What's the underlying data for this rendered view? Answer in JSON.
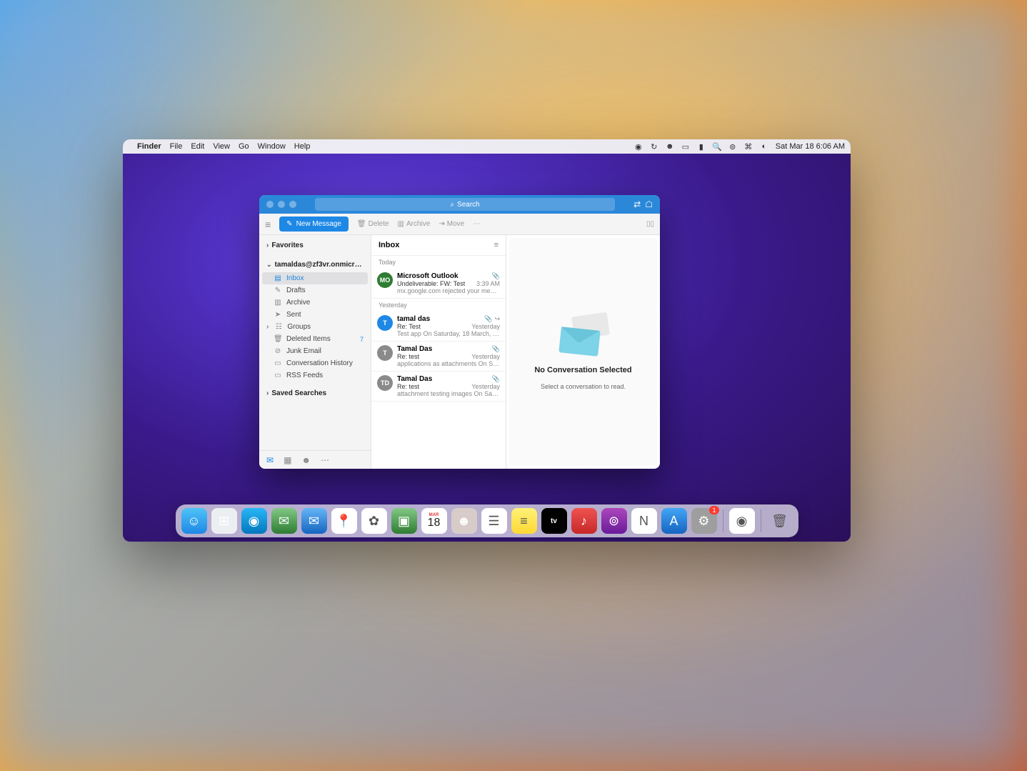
{
  "menubar": {
    "app": "Finder",
    "items": [
      "File",
      "Edit",
      "View",
      "Go",
      "Window",
      "Help"
    ],
    "datetime": "Sat Mar 18  6:06 AM"
  },
  "outlook": {
    "search_placeholder": "Search",
    "new_message": "New Message",
    "toolbar": {
      "delete": "Delete",
      "archive": "Archive",
      "move": "Move"
    },
    "sidebar": {
      "favorites": "Favorites",
      "account": "tamaldas@zf3vr.onmicroso...",
      "folders": [
        {
          "icon": "inbox",
          "label": "Inbox",
          "active": true
        },
        {
          "icon": "drafts",
          "label": "Drafts"
        },
        {
          "icon": "archive",
          "label": "Archive"
        },
        {
          "icon": "sent",
          "label": "Sent"
        },
        {
          "icon": "groups",
          "label": "Groups",
          "expandable": true
        },
        {
          "icon": "trash",
          "label": "Deleted Items",
          "count": "7"
        },
        {
          "icon": "junk",
          "label": "Junk Email"
        },
        {
          "icon": "conv",
          "label": "Conversation History"
        },
        {
          "icon": "rss",
          "label": "RSS Feeds"
        }
      ],
      "saved_searches": "Saved Searches"
    },
    "list": {
      "title": "Inbox",
      "groups": [
        {
          "label": "Today",
          "items": [
            {
              "avatar_bg": "#2e7d32",
              "avatar_text": "MO",
              "sender": "Microsoft Outlook",
              "subject": "Undeliverable: FW: Test",
              "time": "3:39 AM",
              "preview": "mx.google.com rejected your messa...",
              "attach": true
            }
          ]
        },
        {
          "label": "Yesterday",
          "items": [
            {
              "avatar_bg": "#1e88e5",
              "avatar_text": "T",
              "sender": "tamal das",
              "subject": "Re: Test",
              "time": "Yesterday",
              "preview": "Test app On Saturday, 18 March, 20...",
              "attach": true,
              "forwarded": true
            },
            {
              "avatar_bg": "#8a8a8a",
              "avatar_text": "T",
              "sender": "Tamal Das",
              "subject": "Re: test",
              "time": "Yesterday",
              "preview": "applications as attachments On Sat,...",
              "attach": true
            },
            {
              "avatar_bg": "#8a8a8a",
              "avatar_text": "TD",
              "sender": "Tamal Das",
              "subject": "Re: test",
              "time": "Yesterday",
              "preview": "attachment testing images On Sat,...",
              "attach": true
            }
          ]
        }
      ]
    },
    "reading": {
      "title": "No Conversation Selected",
      "subtitle": "Select a conversation to read."
    }
  },
  "dock": {
    "items": [
      {
        "name": "finder",
        "bg": "linear-gradient(#4fc3f7,#1e88e5)",
        "glyph": "☺"
      },
      {
        "name": "launchpad",
        "bg": "#eceff1",
        "glyph": "⊞"
      },
      {
        "name": "safari",
        "bg": "linear-gradient(#29b6f6,#0277bd)",
        "glyph": "◉"
      },
      {
        "name": "messages",
        "bg": "linear-gradient(#81c784,#2e7d32)",
        "glyph": "✉"
      },
      {
        "name": "mail",
        "bg": "linear-gradient(#64b5f6,#1565c0)",
        "glyph": "✉"
      },
      {
        "name": "maps",
        "bg": "#fff",
        "glyph": "📍"
      },
      {
        "name": "photos",
        "bg": "#fff",
        "glyph": "✿"
      },
      {
        "name": "facetime",
        "bg": "linear-gradient(#81c784,#2e7d32)",
        "glyph": "▣"
      },
      {
        "name": "calendar",
        "bg": "#fff",
        "glyph": "18",
        "text": "MAR"
      },
      {
        "name": "contacts",
        "bg": "#d7ccc8",
        "glyph": "☻"
      },
      {
        "name": "reminders",
        "bg": "#fff",
        "glyph": "☰"
      },
      {
        "name": "notes",
        "bg": "linear-gradient(#fff176,#fdd835)",
        "glyph": "≡"
      },
      {
        "name": "tv",
        "bg": "#000",
        "glyph": "tv"
      },
      {
        "name": "music",
        "bg": "linear-gradient(#ef5350,#c62828)",
        "glyph": "♪"
      },
      {
        "name": "podcasts",
        "bg": "linear-gradient(#ab47bc,#6a1b9a)",
        "glyph": "⊚"
      },
      {
        "name": "news",
        "bg": "#fff",
        "glyph": "N"
      },
      {
        "name": "appstore",
        "bg": "linear-gradient(#42a5f5,#1565c0)",
        "glyph": "A"
      },
      {
        "name": "settings",
        "bg": "#9e9e9e",
        "glyph": "⚙",
        "badge": "1"
      }
    ],
    "sep_items": [
      {
        "name": "outlook",
        "bg": "#fff",
        "glyph": "◉"
      }
    ],
    "trash": {
      "name": "trash",
      "bg": "transparent",
      "glyph": "🗑"
    }
  }
}
